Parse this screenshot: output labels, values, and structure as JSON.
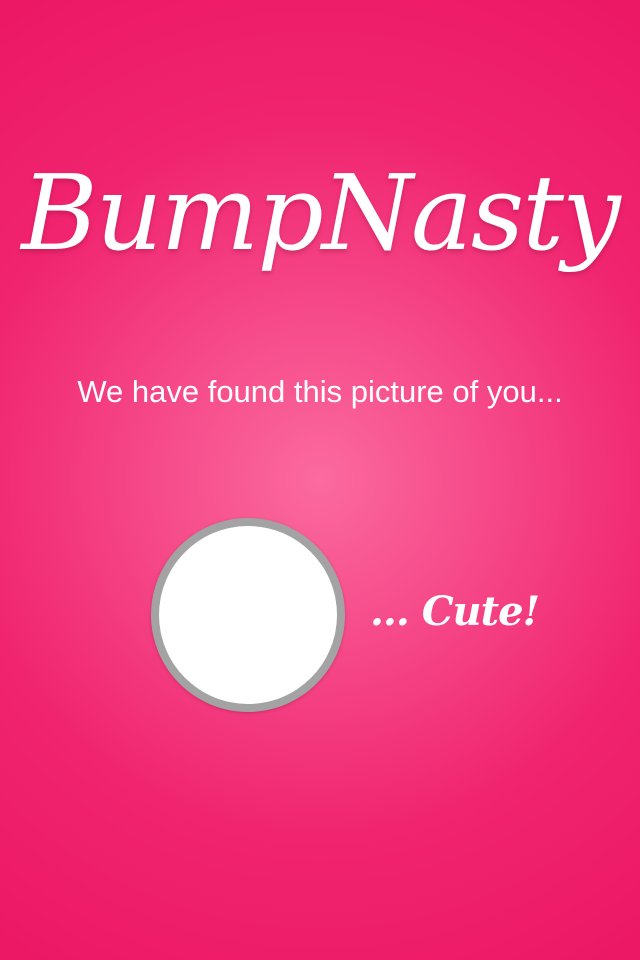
{
  "app": {
    "logo_text": "BumpNasty"
  },
  "main": {
    "message": "We have found this picture of you...",
    "reaction": "... Cute!"
  },
  "colors": {
    "background_edge": "#ec1765",
    "background_center": "#fb6a9e",
    "text": "#ffffff",
    "photo_ring": "#a3a3a3",
    "photo_fill": "#ffffff"
  }
}
